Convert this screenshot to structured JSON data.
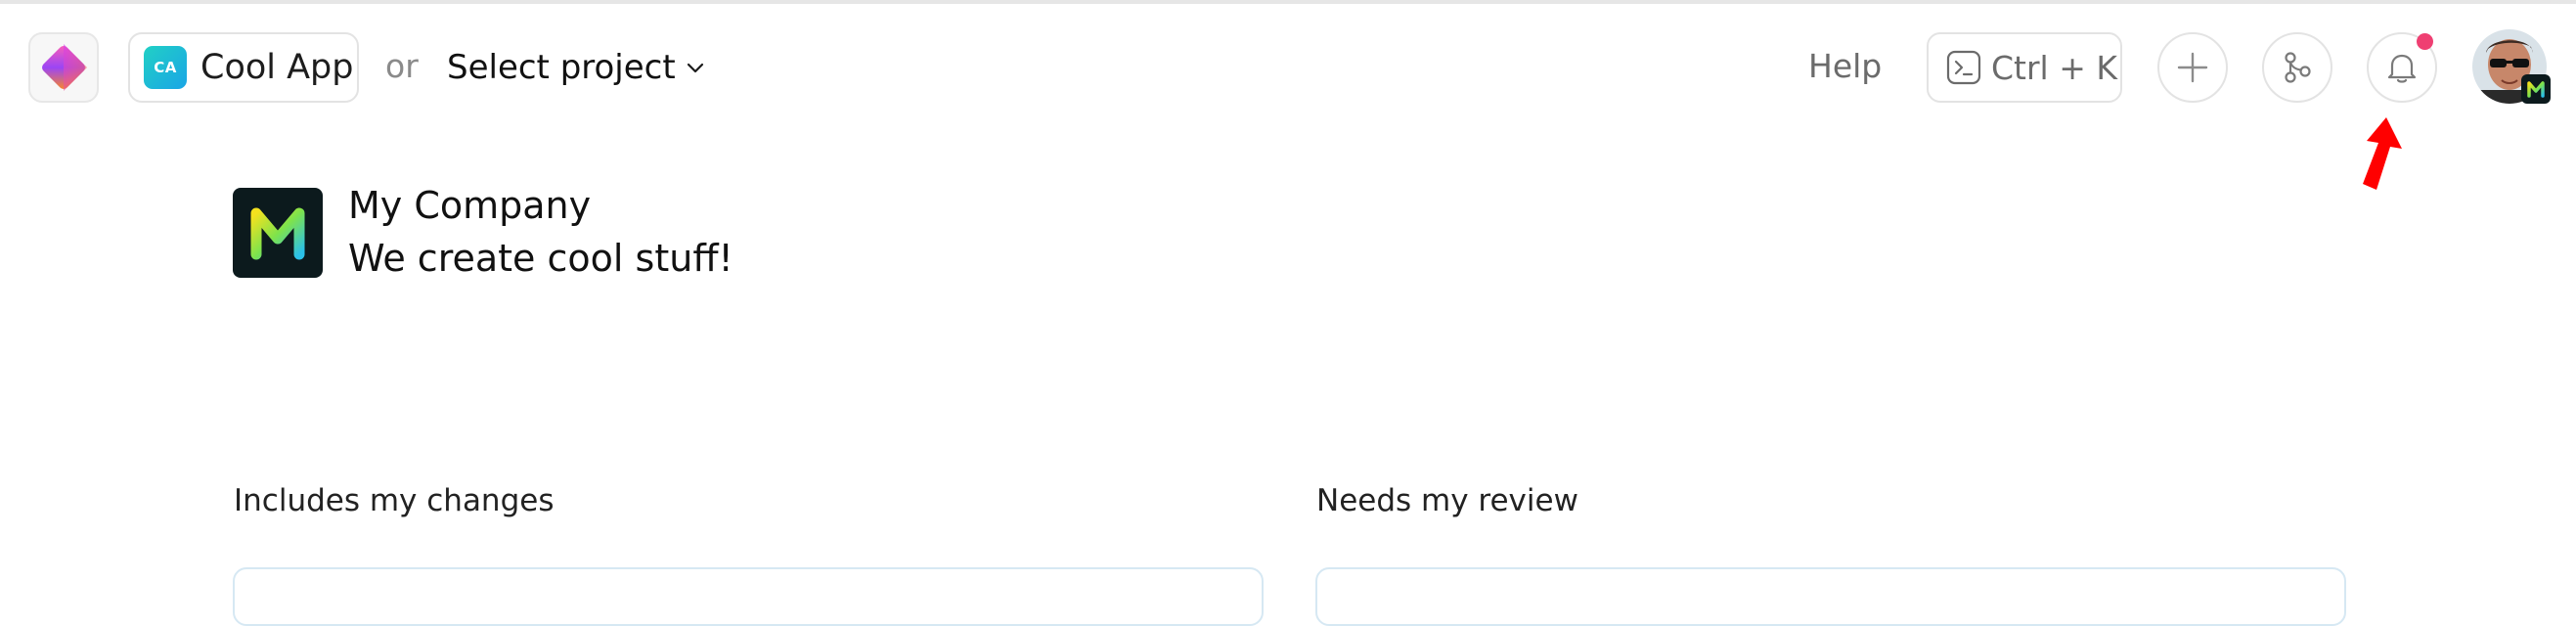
{
  "header": {
    "app_chip": {
      "badge": "CA",
      "label": "Cool App"
    },
    "or_label": "or",
    "project_select": {
      "label": "Select project"
    },
    "help_label": "Help",
    "command_shortcut": "Ctrl + K",
    "notifications": {
      "unread_dot_color": "#ef3f72"
    },
    "icons": [
      "app-logo-icon",
      "terminal-icon",
      "plus-icon",
      "git-merge-icon",
      "bell-icon",
      "chevron-down-icon",
      "user-avatar"
    ]
  },
  "company": {
    "name": "My Company",
    "tagline": "We create cool stuff!"
  },
  "sections": {
    "left": {
      "title": "Includes my changes"
    },
    "right": {
      "title": "Needs my review"
    }
  },
  "colors": {
    "notification_dot": "#ef3f72",
    "annotation_arrow": "#ff0000",
    "card_border": "#d6e8f3"
  }
}
